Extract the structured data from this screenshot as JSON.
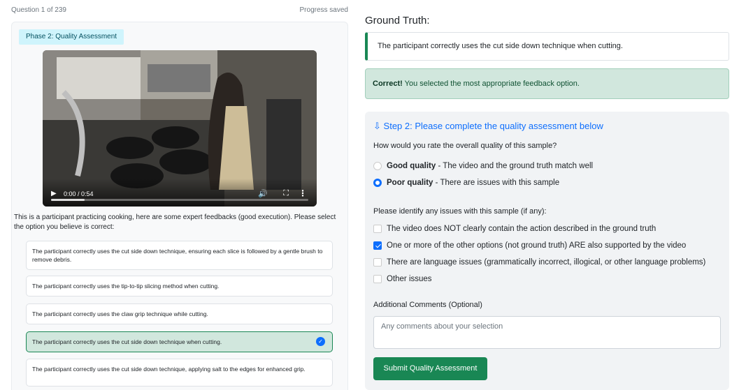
{
  "header": {
    "question_counter": "Question 1 of 239",
    "save_status": "Progress saved"
  },
  "phase_badge": "Phase 2: Quality Assessment",
  "video": {
    "time": "0:00 / 0:54",
    "progress": 0.13
  },
  "prompt": "This is a participant practicing cooking, here are some expert feedbacks (good execution). Please select the option you believe is correct:",
  "options": [
    {
      "text": "The participant correctly uses the cut side down technique, ensuring each slice is followed by a gentle brush to remove debris.",
      "selected": false
    },
    {
      "text": "The participant correctly uses the tip-to-tip slicing method when cutting.",
      "selected": false
    },
    {
      "text": "The participant correctly uses the claw grip technique while cutting.",
      "selected": false
    },
    {
      "text": "The participant correctly uses the cut side down technique when cutting.",
      "selected": true
    },
    {
      "text": "The participant correctly uses the cut side down technique, applying salt to the edges for enhanced grip.",
      "selected": false
    }
  ],
  "ground_truth": {
    "title": "Ground Truth:",
    "text": "The participant correctly uses the cut side down technique when cutting."
  },
  "result": {
    "strong": "Correct!",
    "message": " You selected the most appropriate feedback option."
  },
  "step2": {
    "title": "Step 2: Please complete the quality assessment below",
    "question": "How would you rate the overall quality of this sample?",
    "radios": [
      {
        "bold": "Good quality",
        "rest": " - The video and the ground truth match well",
        "checked": false
      },
      {
        "bold": "Poor quality",
        "rest": " - There are issues with this sample",
        "checked": true
      }
    ],
    "issues_question": "Please identify any issues with this sample (if any):",
    "issues": [
      {
        "label": "The video does NOT clearly contain the action described in the ground truth",
        "checked": false
      },
      {
        "label": "One or more of the other options (not ground truth) ARE also supported by the video",
        "checked": true
      },
      {
        "label": "There are language issues (grammatically incorrect, illogical, or other language problems)",
        "checked": false
      },
      {
        "label": "Other issues",
        "checked": false
      }
    ],
    "comments_label": "Additional Comments (Optional)",
    "comments_placeholder": "Any comments about your selection",
    "submit_label": "Submit Quality Assessment"
  },
  "colors": {
    "success": "#198754",
    "primary": "#0d6efd",
    "info_bg": "#cff4fc"
  }
}
